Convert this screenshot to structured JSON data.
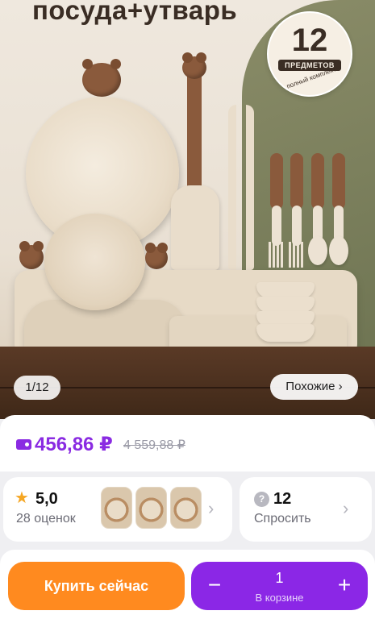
{
  "product_image": {
    "title": "посуда+утварь",
    "badge": {
      "count": "12",
      "label": "ПРЕДМЕТОВ",
      "sublabel": "полный комплект"
    },
    "counter": "1/12",
    "similar_button": "Похожие ›"
  },
  "price": {
    "current": "456,86 ₽",
    "old": "4 559,88 ₽",
    "accent_color": "#8a2be2"
  },
  "rating": {
    "value": "5,0",
    "reviews": "28 оценок",
    "icon": "star-icon"
  },
  "questions": {
    "count": "12",
    "label": "Спросить",
    "icon": "chat-icon"
  },
  "actions": {
    "buy_label": "Купить сейчас",
    "buy_color": "#ff8a1f",
    "cart_quantity": "1",
    "cart_label": "В корзине",
    "cart_minus": "−",
    "cart_plus": "+",
    "cart_color": "#8b27e6"
  }
}
